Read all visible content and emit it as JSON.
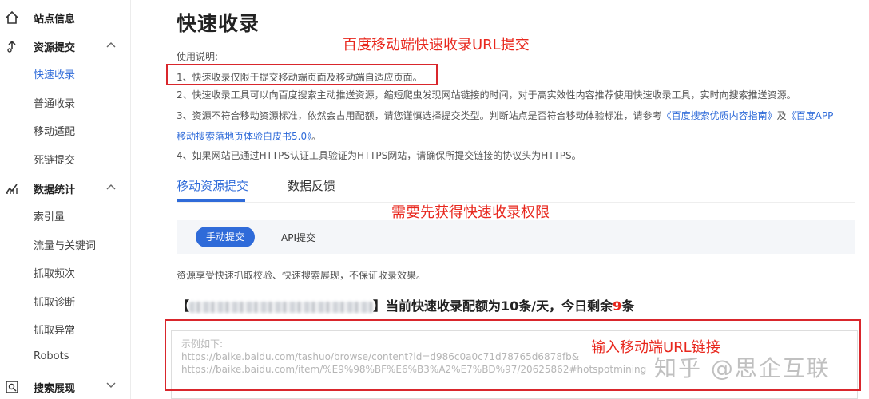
{
  "sidebar": {
    "groups": [
      {
        "label": "站点信息",
        "icon": "home-icon"
      },
      {
        "label": "资源提交",
        "icon": "submit-icon",
        "items": [
          "快速收录",
          "普通收录",
          "移动适配",
          "死链提交"
        ]
      },
      {
        "label": "数据统计",
        "icon": "stats-icon",
        "items": [
          "索引量",
          "流量与关键词",
          "抓取频次",
          "抓取诊断",
          "抓取异常",
          "Robots"
        ]
      },
      {
        "label": "搜索展现",
        "icon": "search-display-icon"
      }
    ],
    "active_item": "快速收录"
  },
  "page": {
    "title": "快速收录",
    "instructions_heading": "使用说明:",
    "instructions": [
      "1、快速收录仅限于提交移动端页面及移动端自适应页面。",
      "2、快速收录工具可以向百度搜索主动推送资源，缩短爬虫发现网站链接的时间，对于高实效性内容推荐使用快速收录工具，实时向搜索推送资源。"
    ],
    "instr3_prefix": "3、资源不符合移动资源标准，依然会占用配额，请您谨慎选择提交类型。判断站点是否符合移动体验标准，请参考",
    "instr3_link1": "《百度搜索优质内容指南》",
    "instr3_and": "及",
    "instr3_link2a": "《百度APP",
    "instr3_link2b": "移动搜索落地页体验白皮书5.0》",
    "instr3_end": "。",
    "instr4": "4、如果网站已通过HTTPS认证工具验证为HTTPS网站，请确保所提交链接的协议头为HTTPS。",
    "tabs": [
      "移动资源提交",
      "数据反馈"
    ],
    "subtabs": [
      "手动提交",
      "API提交"
    ],
    "description": "资源享受快速抓取校验、快速搜索展现，不保证收录效果。",
    "quota_open": "【",
    "quota_close": "】当前快速收录配额为10条/天，今日剩余",
    "quota_remaining": "9",
    "quota_unit": "条",
    "textarea_lines": [
      "示例如下:",
      "https://baike.baidu.com/tashuo/browse/content?id=d986c0a0c71d78765d6878fb&",
      "https://baike.baidu.com/item/%E9%98%BF%E6%B3%A2%E7%BD%97/20625862#hotspotmining"
    ]
  },
  "annotations": {
    "top": "百度移动端快速收录URL提交",
    "middle": "需要先获得快速收录权限",
    "bottom": "输入移动端URL链接"
  },
  "watermark": "知乎 @思企互联",
  "colors": {
    "accent": "#2f6bd9",
    "annotation": "#e8271d"
  }
}
